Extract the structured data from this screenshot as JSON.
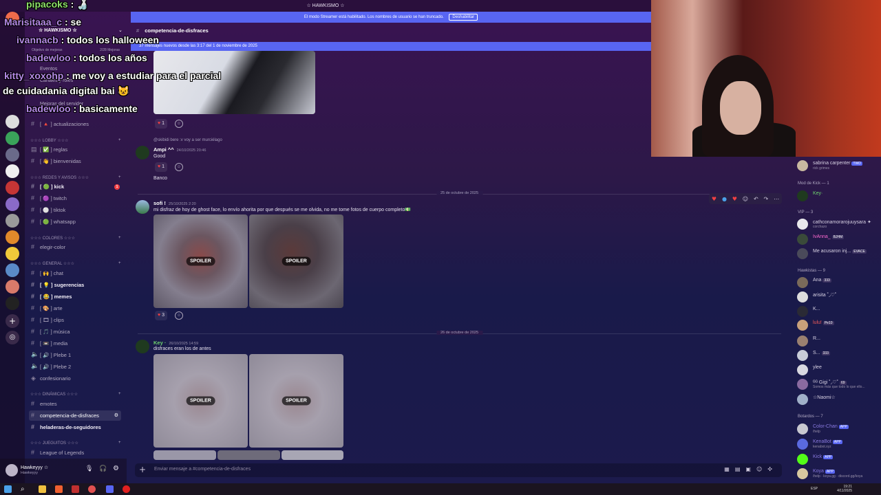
{
  "window": {
    "title": "☆ HAWKISMO ☆"
  },
  "streamer_bar": {
    "text": "El modo Streamer está habilitado. Los nombres de usuario se han truncado.",
    "button": "Deshabilitar"
  },
  "server": {
    "name": "☆ HAWKISMO ☆",
    "goal_label": "Objetivo de mejoras",
    "goal_value": "2/28 Mejoras",
    "events": "Eventos",
    "channels_roles": "Canales y roles",
    "boosts": "Mejoras del servidor"
  },
  "channels": {
    "top": [
      {
        "name": "[ 🔺 ] actualizaciones"
      }
    ],
    "categories": [
      {
        "name": "☆☆☆ LOBBY ☆☆☆"
      },
      {
        "name": "☆☆☆ REDES Y AVISOS ☆☆☆"
      },
      {
        "name": "☆☆☆ COLORES ☆☆☆"
      },
      {
        "name": "☆☆☆ GENERAL ☆☆☆"
      },
      {
        "name": "☆☆☆ DINÁMICAS ☆☆☆"
      },
      {
        "name": "☆☆☆ JUEGUITOS ☆☆☆"
      }
    ],
    "items": [
      {
        "name": "[ ✅ ] reglas"
      },
      {
        "name": "[ 👋 ] bienvenidas"
      },
      {
        "name": "[ 🟢 ] kick",
        "badge": "1"
      },
      {
        "name": "[ 🟣 ] twitch"
      },
      {
        "name": "[ ⚪ ] tiktok"
      },
      {
        "name": "[ 🟢 ] whatsapp"
      },
      {
        "name": "elegir-color"
      },
      {
        "name": "[ 🙌 ] chat"
      },
      {
        "name": "[ 💡 ] sugerencias"
      },
      {
        "name": "[ 😂 ] memes"
      },
      {
        "name": "[ 🎨 ] arte"
      },
      {
        "name": "[ 🎞 ] clips"
      },
      {
        "name": "[ 🎵 ] música"
      },
      {
        "name": "[ 📼 ] media"
      },
      {
        "name": "[ 🔊 ] Plebe 1"
      },
      {
        "name": "[ 🔊 ] Plebe 2"
      },
      {
        "name": "confesionario"
      },
      {
        "name": "emotes"
      },
      {
        "name": "competencia-de-disfraces"
      },
      {
        "name": "heladeras-de-seguidores"
      },
      {
        "name": "League of Legends"
      }
    ]
  },
  "user_panel": {
    "name": "Hawkeyyy ☆",
    "status": "Hawkeyyy"
  },
  "chat": {
    "channel": "competencia-de-disfraces",
    "new_messages": "37 mensajes nuevos desde las 3:17 del 1 de noviembre de 2025",
    "composer_placeholder": "Enviar mensaje a #competencia-de-disfraces",
    "reply_ref": "@skibidi bere :v voy a ser murciélago",
    "messages": [
      {
        "author": "Ampi ^^",
        "time": "24/10/2025 20:46",
        "text": "Good",
        "text2": "Banco",
        "reaction_count": "1"
      },
      {
        "author": "sofi !",
        "time": "25/10/2025 2:20",
        "text": "mi disfraz de hoy de ghost face, lo envío ahorita por que después se me olvida, no me tome fotos de cuerpo completo💵",
        "reaction_count": "3"
      },
      {
        "author": "Key ·",
        "time": "26/10/2025 14:59",
        "text": "disfraces eran los de antes"
      }
    ],
    "top_reaction_count": "1",
    "dividers": [
      "25 de octubre de 2025",
      "26 de octubre de 2025"
    ],
    "spoiler_label": "SPOILER"
  },
  "members": {
    "top": [
      {
        "name": "sabrina carpenter",
        "tag": "TWD",
        "status": "rick grimes"
      }
    ],
    "groups": [
      {
        "label": "Mod de Kick — 1",
        "members": [
          {
            "name": "Key·"
          }
        ]
      },
      {
        "label": "VIP — 3",
        "members": [
          {
            "name": "cathconamorarojuuysara ✦",
            "status": "corchazo"
          },
          {
            "name": "IvAnna_",
            "tag": "BJHM"
          },
          {
            "name": "Me acusaron inj...",
            "tag": "EVACE"
          }
        ]
      },
      {
        "label": "Hawkistas — 9",
        "members": [
          {
            "name": "Ana",
            "tag": "333"
          },
          {
            "name": "arisita ˚◞♡˚"
          },
          {
            "name": "K..."
          },
          {
            "name": "lulu!",
            "tag": "Pe10"
          },
          {
            "name": "R..."
          },
          {
            "name": "S...",
            "tag": "333"
          },
          {
            "name": "ylee"
          },
          {
            "name": "ᴳᴳ Gigi ˚◞♡˚",
            "tag": "69",
            "status": "Somos más que todo lo que ello..."
          },
          {
            "name": "☆Naomi☆"
          }
        ]
      },
      {
        "label": "Botardos — 7",
        "members": [
          {
            "name": "Color-Chan",
            "tag": "APP",
            "status": "/help"
          },
          {
            "name": "KenaBot",
            "tag": "APP",
            "status": "kenabot.xyz"
          },
          {
            "name": "Kick",
            "tag": "APP"
          },
          {
            "name": "Koya",
            "tag": "APP",
            "status": "/help · koya.gg · discord.gg/koya"
          }
        ]
      }
    ]
  },
  "overlay_chat": [
    {
      "user": "pipacoks",
      "text": ": 🍶"
    },
    {
      "user": "Marisitaaa_c",
      "text": ": se"
    },
    {
      "user": "ivannacb",
      "text": ": todos los halloween"
    },
    {
      "user": "badewloo",
      "text": ": todos los años"
    },
    {
      "user": "kitty_xoxohp",
      "text": ": me voy a estudiar para el parcial"
    },
    {
      "user": "",
      "text": "de cuidadania digital bai 😺"
    },
    {
      "user": "badewloo",
      "text": ": basicamente"
    }
  ],
  "taskbar": {
    "time": "19:21",
    "date": "4/11/2025",
    "lang": "ESP"
  },
  "colors": {
    "accent": "#5865f2",
    "danger": "#f23f43"
  }
}
